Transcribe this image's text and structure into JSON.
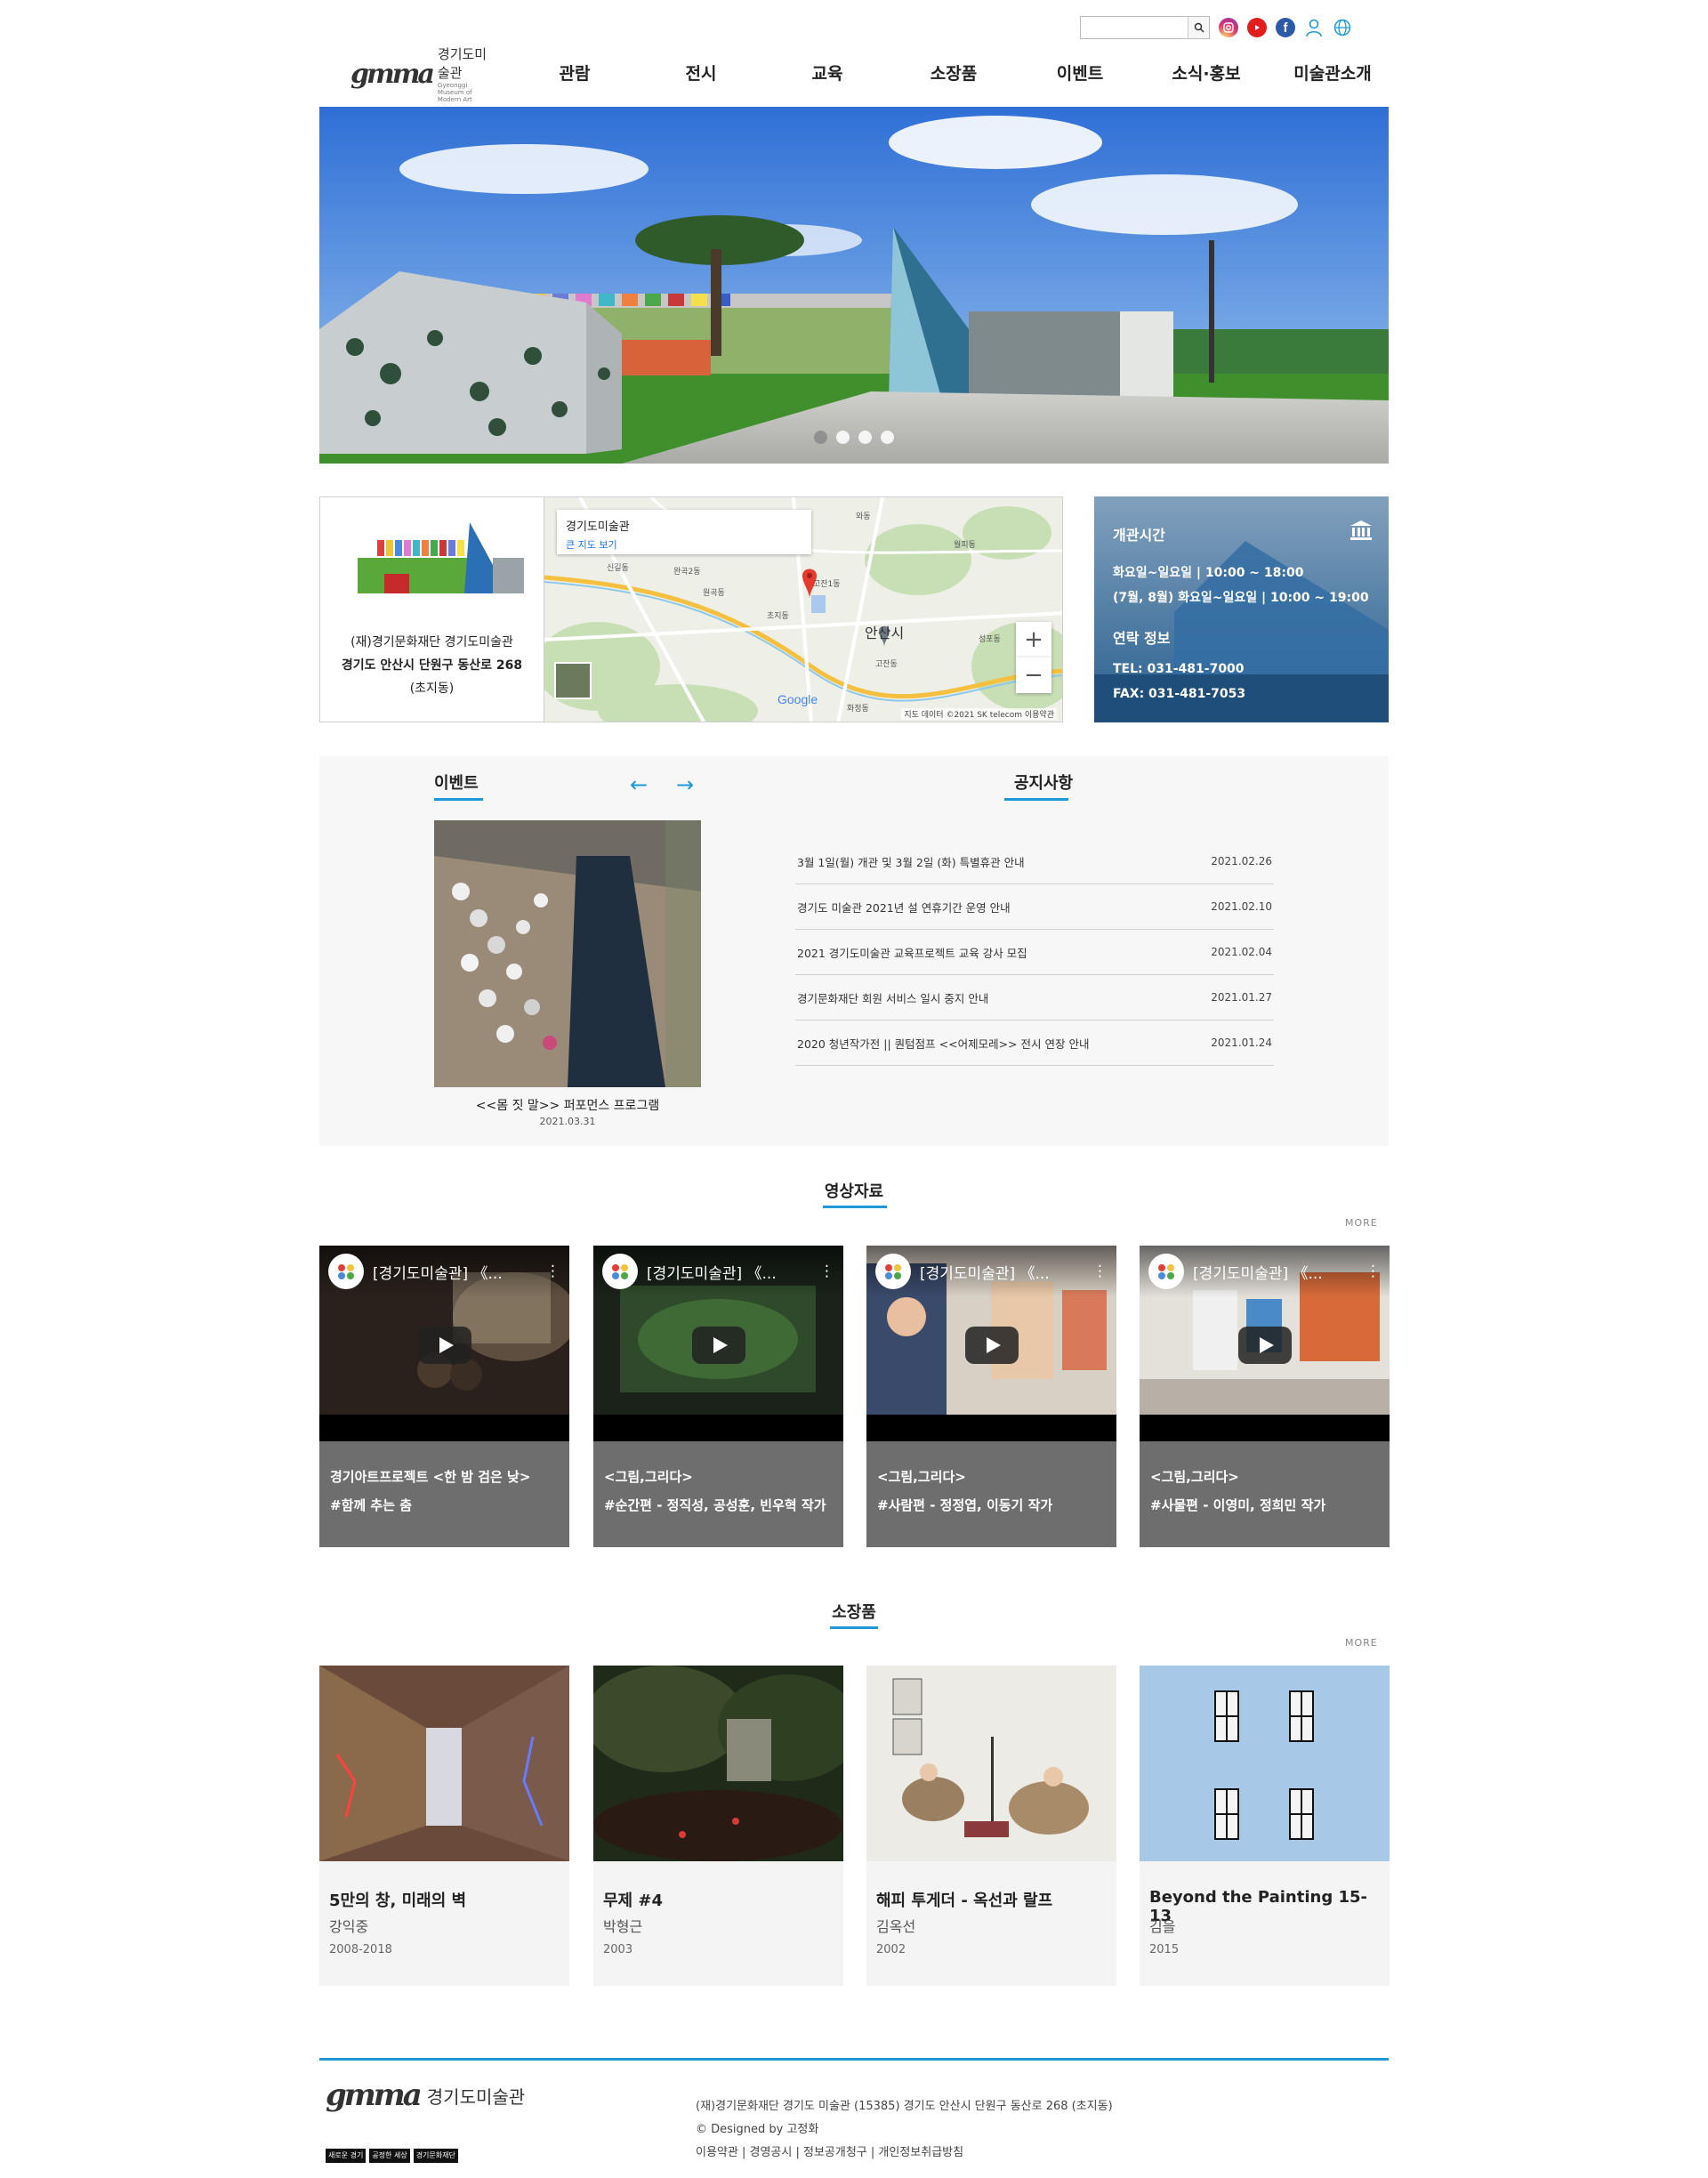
{
  "utility": {
    "search_placeholder": "",
    "icons": [
      "instagram-icon",
      "youtube-icon",
      "facebook-icon",
      "user-icon",
      "globe-icon"
    ]
  },
  "header": {
    "logo_mark": "gmma",
    "logo_ko": "경기도미술관",
    "logo_en": "Gyeonggi Museum of Modern Art",
    "nav": [
      "관람",
      "전시",
      "교육",
      "소장품",
      "이벤트",
      "소식·홍보",
      "미술관소개"
    ]
  },
  "hero": {
    "slide_count": 4,
    "active_slide": 1
  },
  "address": {
    "line1": "(재)경기문화재단 경기도미술관",
    "line2": "경기도 안산시 단원구 동산로 268",
    "line3": "(초지동)"
  },
  "map": {
    "popup_title": "경기도미술관",
    "popup_link": "큰 지도 보기",
    "zoom_in": "+",
    "zoom_out": "−",
    "attribution": "지도 데이터 ©2021 SK telecom    이용약관",
    "google": "Google",
    "labels": [
      "완곡2동",
      "원곡동",
      "고잔1동",
      "안산시",
      "초지동",
      "고잔동",
      "신길동",
      "월피동",
      "성포동",
      "와동",
      "화정동"
    ]
  },
  "hours": {
    "title": "개관시간",
    "line1": "화요일~일요일  |  10:00 ~ 18:00",
    "line2": "(7월, 8월) 화요일~일요일  |  10:00 ~ 19:00",
    "contact_title": "연락 정보",
    "tel": "TEL: 031-481-7000",
    "fax": "FAX: 031-481-7053"
  },
  "event": {
    "section_title": "이벤트",
    "prev": "←",
    "next": "→",
    "item_title": "<<몸 짓 말>> 퍼포먼스 프로그램",
    "item_date": "2021.03.31"
  },
  "notice": {
    "section_title": "공지사항",
    "items": [
      {
        "title": "3월 1일(월) 개관 및 3월 2일 (화) 특별휴관 안내",
        "date": "2021.02.26"
      },
      {
        "title": "경기도 미술관 2021년 설 연휴기간 운영 안내",
        "date": "2021.02.10"
      },
      {
        "title": "2021 경기도미술관 교육프로젝트 교육 강사 모집",
        "date": "2021.02.04"
      },
      {
        "title": "경기문화재단 회원 서비스 일시 중지 안내",
        "date": "2021.01.27"
      },
      {
        "title": "2020 청년작가전 || 퀀텀점프 <<어제모레>> 전시 연장 안내",
        "date": "2021.01.24"
      }
    ]
  },
  "videos": {
    "section_title": "영상자료",
    "more": "MORE",
    "items": [
      {
        "yt_title": "[경기도미술관] 《...",
        "cap1": "경기아트프로젝트 <한 밤 검은 낮>",
        "cap2": "#함께 추는 춤"
      },
      {
        "yt_title": "[경기도미술관] 《...",
        "cap1": "<그림,그리다>",
        "cap2": "#순간편 - 정직성, 공성훈, 빈우혁 작가"
      },
      {
        "yt_title": "[경기도미술관] 《...",
        "cap1": "<그림,그리다>",
        "cap2": "#사람편 - 정정엽, 이동기 작가"
      },
      {
        "yt_title": "[경기도미술관] 《...",
        "cap1": "<그림,그리다>",
        "cap2": "#사물편 - 이영미, 정희민 작가"
      }
    ]
  },
  "collection": {
    "section_title": "소장품",
    "more": "MORE",
    "items": [
      {
        "title": "5만의 창, 미래의 벽",
        "artist": "강익중",
        "year": "2008-2018"
      },
      {
        "title": "무제 #4",
        "artist": "박형근",
        "year": "2003"
      },
      {
        "title": "해피 투게더 - 옥선과 랄프",
        "artist": "김옥선",
        "year": "2002"
      },
      {
        "title": "Beyond the Painting 15-13",
        "artist": "김을",
        "year": "2015"
      }
    ]
  },
  "footer": {
    "logo_mark": "gmma",
    "logo_ko": "경기도미술관",
    "badges": [
      "새로운 경기",
      "공정한 세상",
      "경기문화재단"
    ],
    "address": "(재)경기문화재단 경기도 미술관 (15385) 경기도 안산시 단원구 동산로 268 (초지동)",
    "credit": "© Designed by 고정화",
    "links": [
      "이용약관",
      "경영공시",
      "정보공개청구",
      "개인정보취급방침"
    ],
    "sep": " | "
  },
  "colors": {
    "accent": "#1e98d7",
    "video_bg": "#6e6e6e",
    "section_bg": "#f7f7f7"
  }
}
